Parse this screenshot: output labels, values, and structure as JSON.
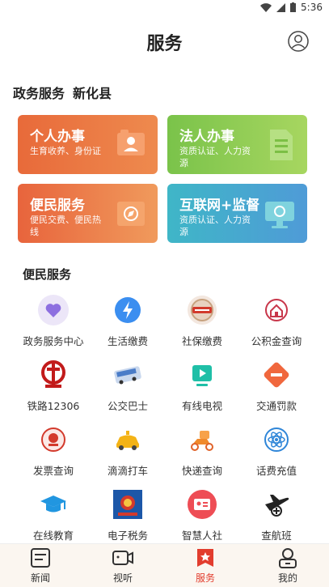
{
  "status_bar": {
    "time": "5:36"
  },
  "header": {
    "title": "服务"
  },
  "gov_section": {
    "title": "政务服务",
    "county": "新化县"
  },
  "cards": [
    {
      "title": "个人办事",
      "subtitle": "生育收养、身份证"
    },
    {
      "title": "法人办事",
      "subtitle": "资质认证、人力资源"
    },
    {
      "title": "便民服务",
      "subtitle": "便民交费、便民热线"
    },
    {
      "title": "互联网+监督",
      "subtitle": "资质认证、人力资源"
    }
  ],
  "convenience_section": {
    "title": "便民服务"
  },
  "services": [
    {
      "label": "政务服务中心",
      "icon": "heart-icon"
    },
    {
      "label": "生活缴费",
      "icon": "lightning-icon"
    },
    {
      "label": "社保缴费",
      "icon": "social-security-badge-icon"
    },
    {
      "label": "公积金查询",
      "icon": "house-fund-icon"
    },
    {
      "label": "铁路12306",
      "icon": "railway-logo-icon"
    },
    {
      "label": "公交巴士",
      "icon": "bus-icon"
    },
    {
      "label": "有线电视",
      "icon": "tv-icon"
    },
    {
      "label": "交通罚款",
      "icon": "no-entry-icon"
    },
    {
      "label": "发票查询",
      "icon": "tax-emblem-icon"
    },
    {
      "label": "滴滴打车",
      "icon": "taxi-icon"
    },
    {
      "label": "快递查询",
      "icon": "scooter-icon"
    },
    {
      "label": "话费充值",
      "icon": "atom-icon"
    },
    {
      "label": "在线教育",
      "icon": "graduation-cap-icon"
    },
    {
      "label": "电子税务",
      "icon": "tax-bureau-icon"
    },
    {
      "label": "智慧人社",
      "icon": "id-card-icon"
    },
    {
      "label": "查航班",
      "icon": "airplane-icon"
    }
  ],
  "tabs": [
    {
      "label": "新闻",
      "icon": "news-icon"
    },
    {
      "label": "视听",
      "icon": "video-icon"
    },
    {
      "label": "服务",
      "icon": "service-icon",
      "active": true
    },
    {
      "label": "我的",
      "icon": "profile-icon"
    }
  ],
  "colors": {
    "accent": "#e23d2e",
    "personal": "#e86a3a",
    "legal": "#8bcb52",
    "convenience": "#ec7a48",
    "internet": "#45a8cf"
  }
}
